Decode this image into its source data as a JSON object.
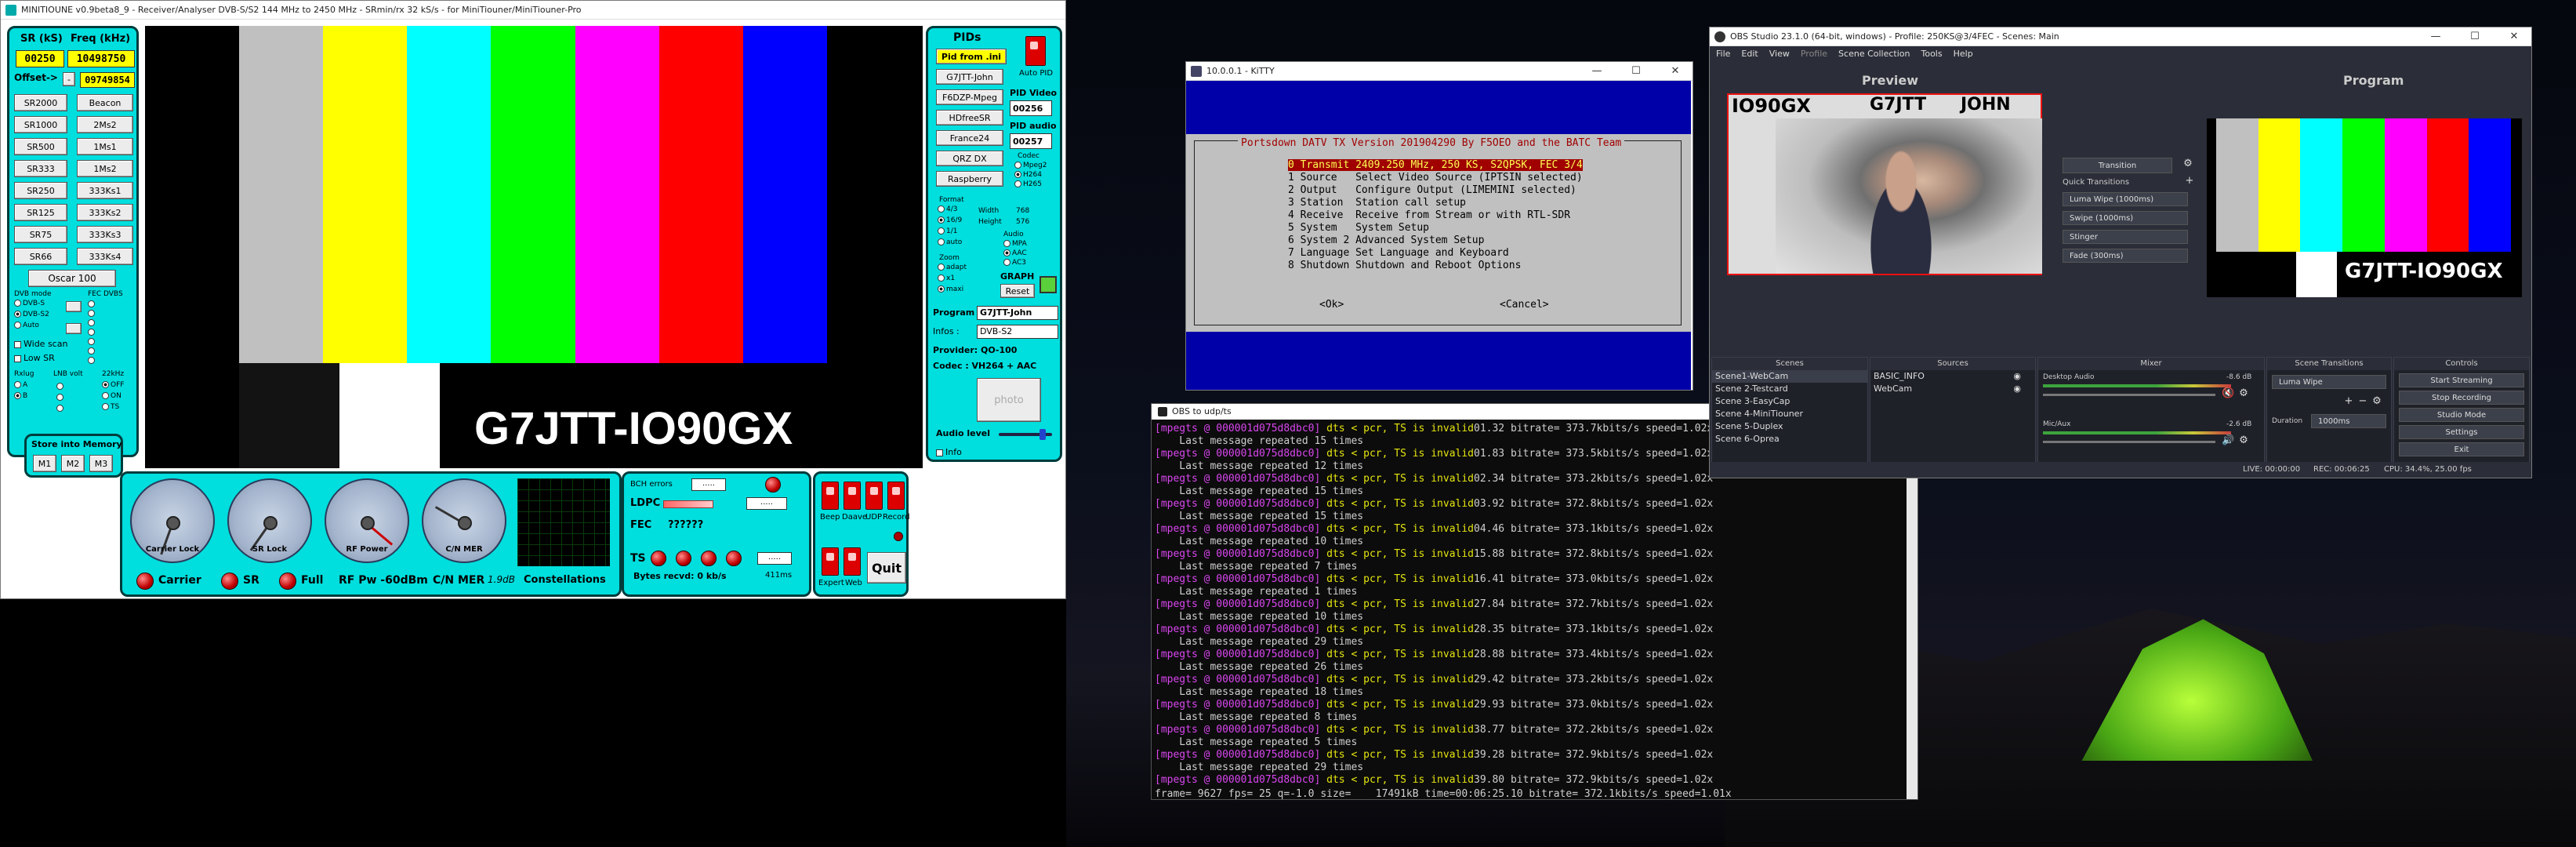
{
  "minitioune": {
    "title": "MINITIOUNE v0.9beta8_9 - Receiver/Analyser DVB-S/S2 144 MHz to 2450 MHz - SRmin/rx 32 kS/s - for MiniTiouner/MiniTiouner-Pro",
    "sr_label": "SR (kS)",
    "freq_label": "Freq (kHz)",
    "sr_value": "00250",
    "freq_value": "10498750",
    "offset_label": "Offset->",
    "offset_value": "09749854",
    "sr_buttons": [
      "SR2000",
      "SR1000",
      "SR500",
      "SR333",
      "SR250",
      "SR125",
      "SR75",
      "SR66"
    ],
    "freq_buttons": [
      "Beacon",
      "2Ms2",
      "1Ms1",
      "1Ms2",
      "333Ks1",
      "333Ks2",
      "333Ks3",
      "333Ks4"
    ],
    "oscar_button": "Oscar 100",
    "dvb_mode_label": "DVB mode",
    "dvb_modes": [
      "DVB-S",
      "DVB-S2",
      "Auto"
    ],
    "fec_label": "FEC DVBS",
    "wide_scan": "Wide scan",
    "low_sr": "Low SR",
    "rxlug_label": "Rxlug",
    "rxlug_a": "A",
    "rxlug_b": "B",
    "lnb_label": "LNB volt",
    "khz_label": "22kHz",
    "khz_off": "OFF",
    "khz_on": "ON",
    "khz_ts": "TS",
    "store_label": "Store into Memory",
    "mem_buttons": [
      "M1",
      "M2",
      "M3"
    ],
    "overlay_text": "G7JTT-IO90GX",
    "pids_label": "PIDs",
    "pid_from_ini": "Pid from .ini",
    "auto_pid": "Auto PID",
    "right_buttons": [
      "G7JTT-John",
      "F6DZP-Mpeg",
      "HDfreeSR",
      "France24",
      "QRZ DX",
      "Raspberry"
    ],
    "pid_video_label": "PID Video",
    "pid_video": "00256",
    "pid_audio_label": "PID audio",
    "pid_audio": "00257",
    "codec_label": "Codec",
    "codec_opts": [
      "Mpeg2",
      "H264",
      "H265"
    ],
    "format_label": "Format",
    "format_opts": [
      "4/3",
      "16/9",
      "1/1",
      "auto"
    ],
    "width_label": "Width",
    "width_value": "768",
    "height_label": "Height",
    "height_value": "576",
    "audio_label": "Audio",
    "audio_opts": [
      "MPA",
      "AAC",
      "AC3"
    ],
    "zoom_label": "Zoom",
    "zoom_opts": [
      "adapt",
      "x1",
      "maxi"
    ],
    "graph_label": "GRAPH",
    "reset_label": "Reset",
    "program_label": "Program",
    "program_value": "G7JTT-John",
    "infos_label": "Infos :",
    "infos_value": "DVB-S2",
    "provider_label": "Provider: QO-100",
    "codec_info": "Codec :  VH264 + AAC",
    "photo_label": "photo",
    "audio_level_label": "Audio level",
    "info_check": "Info",
    "gauges": [
      "Carrier Lock",
      "SR Lock",
      "RF Power",
      "C/N MER"
    ],
    "bottom_carrier": "Carrier",
    "bottom_sr": "SR",
    "bottom_full": "Full",
    "bottom_rfpw": "RF Pw  -60dBm",
    "bottom_cnmer": "C/N MER",
    "bottom_cnmer_val": "1.9dB",
    "constellations": "Constellations",
    "bch_label": "BCH errors",
    "ldpc_label": "LDPC",
    "fec_word": "FEC",
    "fec_value": "??????",
    "ts_label": "TS",
    "bytes_label": "Bytes recvd:  0 kb/s",
    "ms_label": "411ms",
    "switches": [
      "Beep",
      "Daave",
      "UDP",
      "Record"
    ],
    "expert_label": "Expert",
    "web_label": "Web",
    "quit_label": "Quit",
    "colors": {
      "panel": "#00dede",
      "yellow": "#ffff00"
    }
  },
  "kitty": {
    "title": "10.0.0.1 - KiTTY",
    "header": "Portsdown DATV TX Version 201904290 By F5OEO and the BATC Team",
    "selected": "0 Transmit 2409.250 MHz, 250 KS, S2QPSK, FEC 3/4",
    "items": [
      "1 Source   Select Video Source (IPTSIN selected)",
      "2 Output   Configure Output (LIMEMINI selected)",
      "3 Station  Station call setup",
      "4 Receive  Receive from Stream or with RTL-SDR",
      "5 System   System Setup",
      "6 System 2 Advanced System Setup",
      "7 Language Set Language and Keyboard",
      "8 Shutdown Shutdown and Reboot Options"
    ],
    "ok": "<Ok>",
    "cancel": "<Cancel>"
  },
  "terminal": {
    "title": "OBS to udp/ts",
    "prefix": "[mpegts @ 000001d075d8dbc0]",
    "lines": [
      {
        "t": "01.32",
        "b": "373.7kbits/s"
      },
      {
        "r": "15"
      },
      {
        "t": "01.83",
        "b": "373.5kbits/s"
      },
      {
        "r": "12"
      },
      {
        "t": "02.34",
        "b": "373.2kbits/s"
      },
      {
        "r": "15"
      },
      {
        "t": "03.92",
        "b": "372.8kbits/s"
      },
      {
        "r": "15"
      },
      {
        "t": "04.46",
        "b": "373.1kbits/s"
      },
      {
        "r": "10"
      },
      {
        "t": "15.88",
        "b": "372.8kbits/s"
      },
      {
        "r": "7"
      },
      {
        "t": "16.41",
        "b": "373.0kbits/s"
      },
      {
        "r": "1"
      },
      {
        "t": "27.84",
        "b": "372.7kbits/s"
      },
      {
        "r": "10"
      },
      {
        "t": "28.35",
        "b": "373.1kbits/s"
      },
      {
        "r": "29"
      },
      {
        "t": "28.88",
        "b": "373.4kbits/s"
      },
      {
        "r": "26"
      },
      {
        "t": "29.42",
        "b": "373.2kbits/s"
      },
      {
        "r": "18"
      },
      {
        "t": "29.93",
        "b": "373.0kbits/s"
      },
      {
        "r": "8"
      },
      {
        "t": "38.77",
        "b": "372.2kbits/s"
      },
      {
        "r": "5"
      },
      {
        "t": "39.28",
        "b": "372.9kbits/s"
      },
      {
        "r": "29"
      },
      {
        "t": "39.80",
        "b": "372.9kbits/s"
      }
    ],
    "frame_line": "frame= 9627 fps= 25 q=-1.0 size=    17491kB time=00:06:25.10 bitrate= 372.1kbits/s speed=1.01x"
  },
  "obs": {
    "title": "OBS Studio 23.1.0 (64-bit, windows) - Profile: 250KS@3/4FEC - Scenes: Main",
    "menu": [
      "File",
      "Edit",
      "View",
      "Profile",
      "Scene Collection",
      "Tools",
      "Help"
    ],
    "preview_label": "Preview",
    "program_label": "Program",
    "preview_overlay_left": "IO90GX",
    "preview_overlay_mid": "G7JTT",
    "preview_overlay_right": "JOHN",
    "program_overlay": "G7JTT-IO90GX",
    "transition_btn": "Transition",
    "quick_transitions": "Quick Transitions",
    "transitions": [
      "Luma Wipe (1000ms)",
      "Swipe (1000ms)",
      "Stinger",
      "Fade (300ms)"
    ],
    "scenes_header": "Scenes",
    "scenes": [
      "Scene1-WebCam",
      "Scene 2-Testcard",
      "Scene 3-EasyCap",
      "Scene 4-MiniTiouner",
      "Scene 5-Duplex",
      "Scene 6-Oprea"
    ],
    "sources_header": "Sources",
    "sources": [
      "BASIC_INFO",
      "WebCam"
    ],
    "mixer_header": "Mixer",
    "mixer": [
      {
        "name": "Desktop Audio",
        "db": "-8.6 dB"
      },
      {
        "name": "Mic/Aux",
        "db": "-2.6 dB"
      }
    ],
    "scene_trans_header": "Scene Transitions",
    "scene_trans_value": "Luma Wipe",
    "duration_label": "Duration",
    "duration_value": "1000ms",
    "controls_header": "Controls",
    "controls": [
      "Start Streaming",
      "Stop Recording",
      "Studio Mode",
      "Settings",
      "Exit"
    ],
    "status_live": "LIVE: 00:00:00",
    "status_rec": "REC: 00:06:25",
    "status_cpu": "CPU: 34.4%, 25.00 fps"
  }
}
